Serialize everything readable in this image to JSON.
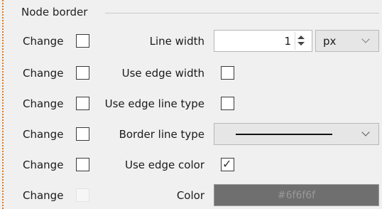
{
  "group": {
    "title": "Node border"
  },
  "rows": [
    {
      "change_label": "Change",
      "change_checked": false,
      "label": "Line width",
      "spin_value": "1",
      "unit_selected": "px"
    },
    {
      "change_label": "Change",
      "change_checked": false,
      "label": "Use edge width",
      "checked": false
    },
    {
      "change_label": "Change",
      "change_checked": false,
      "label": "Use edge line type",
      "checked": false
    },
    {
      "change_label": "Change",
      "change_checked": false,
      "label": "Border line type",
      "line_style": "solid"
    },
    {
      "change_label": "Change",
      "change_checked": false,
      "label": "Use edge color",
      "checked": true
    },
    {
      "change_label": "Change",
      "change_checked": false,
      "change_disabled": true,
      "label": "Color",
      "color_value": "#6f6f6f",
      "color_text": "#6f6f6f"
    }
  ],
  "colors": {
    "background": "#f0f0f0",
    "focus_dots": "#e07a1e",
    "color_swatch": "#6f6f6f"
  },
  "icons": {
    "checkmark": "checkmark-icon",
    "spinner": "spin-arrows-icon",
    "dropdown": "chevron-down-icon"
  }
}
